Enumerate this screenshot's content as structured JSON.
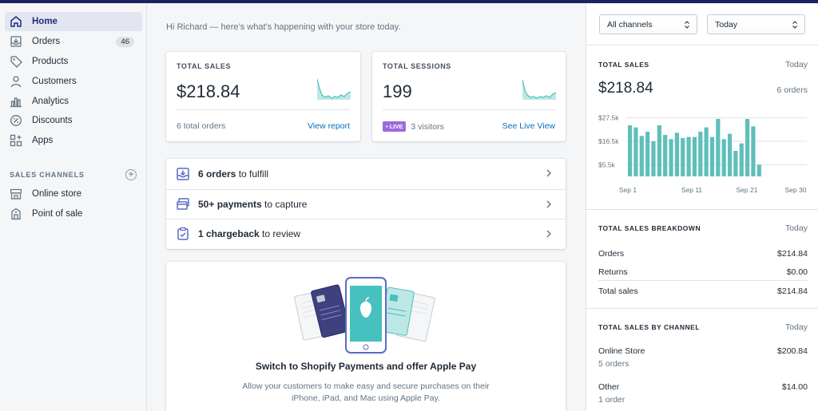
{
  "sidebar": {
    "items": [
      {
        "label": "Home",
        "icon": "home-icon",
        "active": true
      },
      {
        "label": "Orders",
        "icon": "orders-icon",
        "badge": "46"
      },
      {
        "label": "Products",
        "icon": "tag-icon"
      },
      {
        "label": "Customers",
        "icon": "person-icon"
      },
      {
        "label": "Analytics",
        "icon": "bar-chart-icon"
      },
      {
        "label": "Discounts",
        "icon": "discount-icon"
      },
      {
        "label": "Apps",
        "icon": "apps-icon"
      }
    ],
    "channels_title": "SALES CHANNELS",
    "channels": [
      {
        "label": "Online store",
        "icon": "store-icon"
      },
      {
        "label": "Point of sale",
        "icon": "pos-icon"
      }
    ]
  },
  "main": {
    "greeting": "Hi Richard — here’s what’s happening with your store today.",
    "total_sales": {
      "title": "TOTAL SALES",
      "value": "$218.84",
      "footer": "6 total orders",
      "link": "View report"
    },
    "total_sessions": {
      "title": "TOTAL SESSIONS",
      "value": "199",
      "badge": "• LIVE",
      "footer": "3 visitors",
      "link": "See Live View"
    },
    "tasks": [
      {
        "bold": "6 orders",
        "rest": " to fulfill",
        "icon": "fulfill-icon"
      },
      {
        "bold": "50+ payments",
        "rest": " to capture",
        "icon": "payment-icon"
      },
      {
        "bold": "1 chargeback",
        "rest": " to review",
        "icon": "clipboard-icon"
      }
    ],
    "promo": {
      "title": "Switch to Shopify Payments and offer Apple Pay",
      "body": "Allow your customers to make easy and secure purchases on their iPhone, iPad, and Mac using Apple Pay."
    }
  },
  "right": {
    "channel_select": "All channels",
    "period_select": "Today",
    "sales": {
      "title": "TOTAL SALES",
      "period": "Today",
      "value": "$218.84",
      "orders": "6 orders"
    },
    "breakdown": {
      "title": "TOTAL SALES BREAKDOWN",
      "period": "Today",
      "rows": [
        {
          "label": "Orders",
          "value": "$214.84"
        },
        {
          "label": "Returns",
          "value": "$0.00"
        },
        {
          "label": "Total sales",
          "value": "$214.84"
        }
      ]
    },
    "by_channel": {
      "title": "TOTAL SALES BY CHANNEL",
      "period": "Today",
      "rows": [
        {
          "label": "Online Store",
          "sub": "5 orders",
          "value": "$200.84"
        },
        {
          "label": "Other",
          "sub": "1 order",
          "value": "$14.00"
        }
      ]
    }
  },
  "colors": {
    "accent": "#202e78",
    "bar": "#5fbfba",
    "link": "#006fbb",
    "live": "#9c6ade"
  },
  "chart_data": {
    "type": "bar",
    "xticks": [
      "Sep 1",
      "Sep 11",
      "Sep 21",
      "Sep 30"
    ],
    "yticks": [
      "$5.5k",
      "$16.5k",
      "$27.5k"
    ],
    "ylim": [
      0,
      30000
    ],
    "values": [
      24000,
      23000,
      19000,
      21000,
      16500,
      24000,
      19500,
      17500,
      20500,
      18000,
      18500,
      18500,
      21000,
      23000,
      18500,
      27000,
      17500,
      20000,
      12000,
      15500,
      27000,
      23500,
      5500
    ],
    "grid": true
  }
}
